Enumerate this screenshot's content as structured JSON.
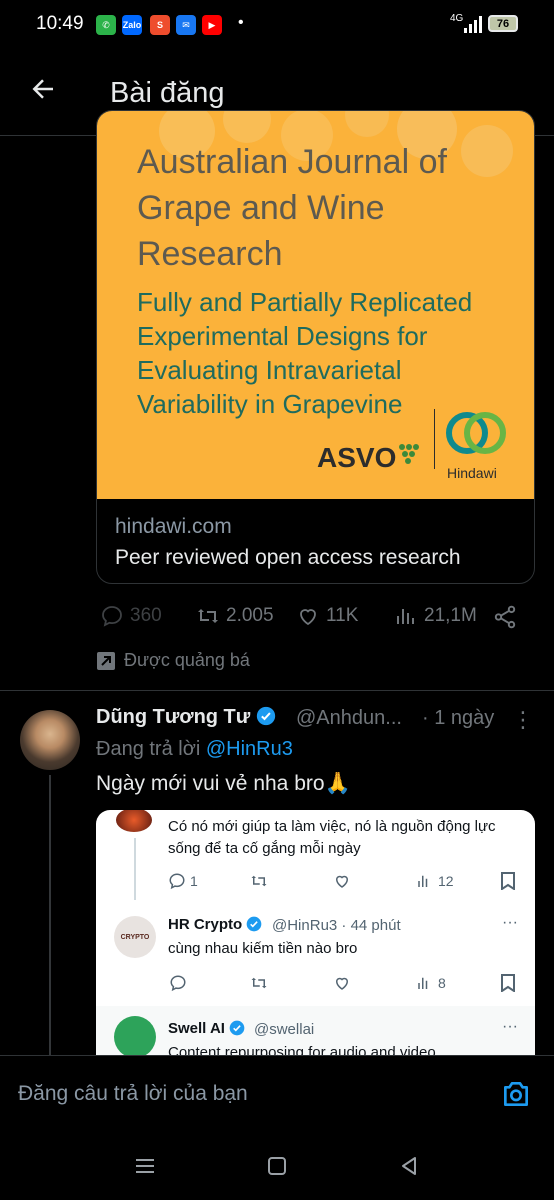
{
  "status_bar": {
    "time": "10:49",
    "network": "4G",
    "battery": "76",
    "apps": [
      "Zalo",
      "Shopee",
      "Messenger",
      "YouTube"
    ]
  },
  "header": {
    "title": "Bài đăng"
  },
  "link_card": {
    "image_journal": "Australian Journal of Grape and Wine Research",
    "image_article": "Fully and Partially Replicated Experimental Designs for Evaluating Intravarietal Variability in Grapevine",
    "image_logo_left": "ASVO",
    "image_logo_right": "Hindawi",
    "domain": "hindawi.com",
    "title": "Peer reviewed open access research"
  },
  "post_actions": {
    "replies": "360",
    "reposts": "2.005",
    "likes": "11K",
    "views": "21,1M"
  },
  "promoted": "Được quảng bá",
  "reply": {
    "name": "Dũng Tương Tư",
    "handle": "@Anhdun...",
    "time": "· 1 ngày",
    "replying_prefix": "Đang trả lời",
    "replying_to": "@HinRu3",
    "text": "Ngày mới vui vẻ nha bro🙏"
  },
  "embedded": {
    "t1_text": "Có nó mới giúp ta làm việc, nó là nguồn động lực sống để ta cố gắng mỗi ngày",
    "t1_replies": "1",
    "t1_views": "12",
    "t2_name": "HR Crypto",
    "t2_handle": "@HinRu3 · 44 phút",
    "t2_avatar": "CRYPTO",
    "t2_text": "cùng nhau kiếm tiền nào bro",
    "t2_views": "8",
    "t3_name": "Swell AI",
    "t3_handle": "@swellai",
    "t3_text": "Content repurposing for audio and video"
  },
  "composer": {
    "placeholder": "Đăng câu trả lời của bạn"
  },
  "colors": {
    "accent": "#1d9bf0",
    "card_bg": "#fbb23a",
    "muted": "#71767b"
  }
}
